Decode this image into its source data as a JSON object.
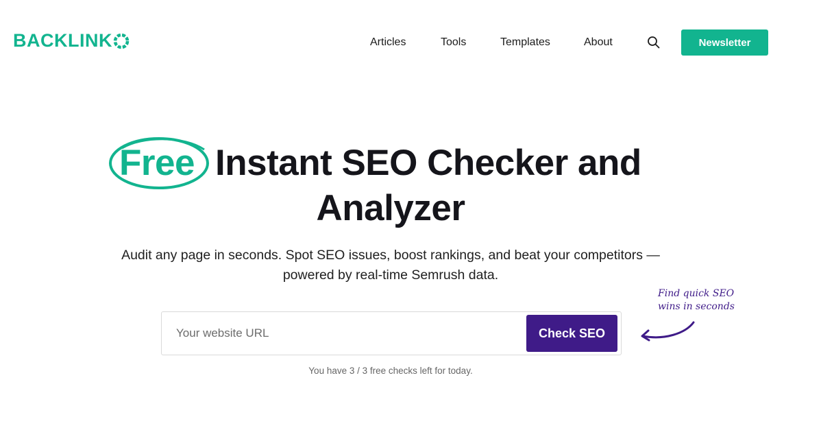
{
  "header": {
    "logo": {
      "text": "BACKLINK",
      "mark_icon": "ring-o-icon"
    },
    "nav": [
      {
        "label": "Articles"
      },
      {
        "label": "Tools"
      },
      {
        "label": "Templates"
      },
      {
        "label": "About"
      }
    ],
    "search_icon": "search-icon",
    "newsletter_label": "Newsletter"
  },
  "hero": {
    "title_highlight": "Free",
    "title_rest": "Instant SEO Checker and",
    "title_line2": "Analyzer",
    "subtitle": "Audit any page in seconds. Spot SEO issues, boost rankings, and beat your competitors — powered by real-time Semrush data."
  },
  "form": {
    "url_placeholder": "Your website URL",
    "url_value": "",
    "button_label": "Check SEO",
    "checks_left_text": "You have 3 / 3 free checks left for today."
  },
  "annotation": {
    "line1": "Find quick SEO",
    "line2": "wins in seconds"
  },
  "colors": {
    "brand_green": "#12b48f",
    "brand_purple": "#3f1b88",
    "text_dark": "#15151b"
  }
}
